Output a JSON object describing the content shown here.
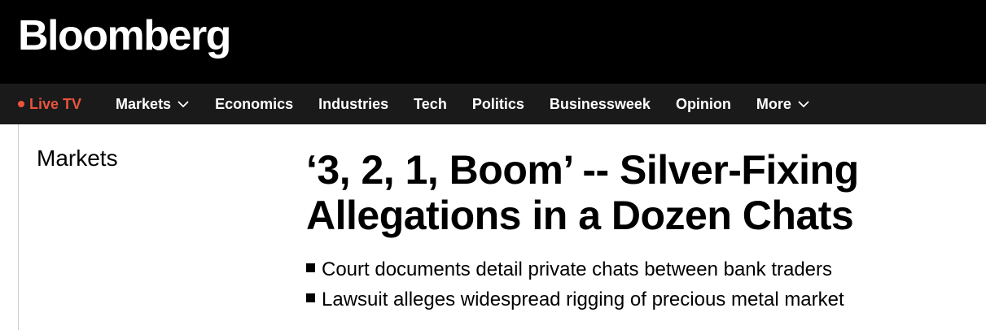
{
  "header": {
    "logo_text": "Bloomberg"
  },
  "nav": {
    "live": {
      "label": "Live TV",
      "color": "#e8543e"
    },
    "items": [
      {
        "label": "Markets",
        "has_dropdown": true
      },
      {
        "label": "Economics",
        "has_dropdown": false
      },
      {
        "label": "Industries",
        "has_dropdown": false
      },
      {
        "label": "Tech",
        "has_dropdown": false
      },
      {
        "label": "Politics",
        "has_dropdown": false
      },
      {
        "label": "Businessweek",
        "has_dropdown": false
      },
      {
        "label": "Opinion",
        "has_dropdown": false
      },
      {
        "label": "More",
        "has_dropdown": true
      }
    ],
    "dropdown_icon": "chevron-down-icon"
  },
  "article": {
    "section": "Markets",
    "headline_line1": "‘3, 2, 1, Boom’ -- Silver-Fixing",
    "headline_line2": "Allegations in a Dozen Chats",
    "bullets": [
      "Court documents detail private chats between bank traders",
      "Lawsuit alleges widespread rigging of precious metal market"
    ]
  },
  "colors": {
    "masthead_bg": "#000000",
    "nav_bg": "#1a1a1a",
    "live_accent": "#e8543e"
  }
}
